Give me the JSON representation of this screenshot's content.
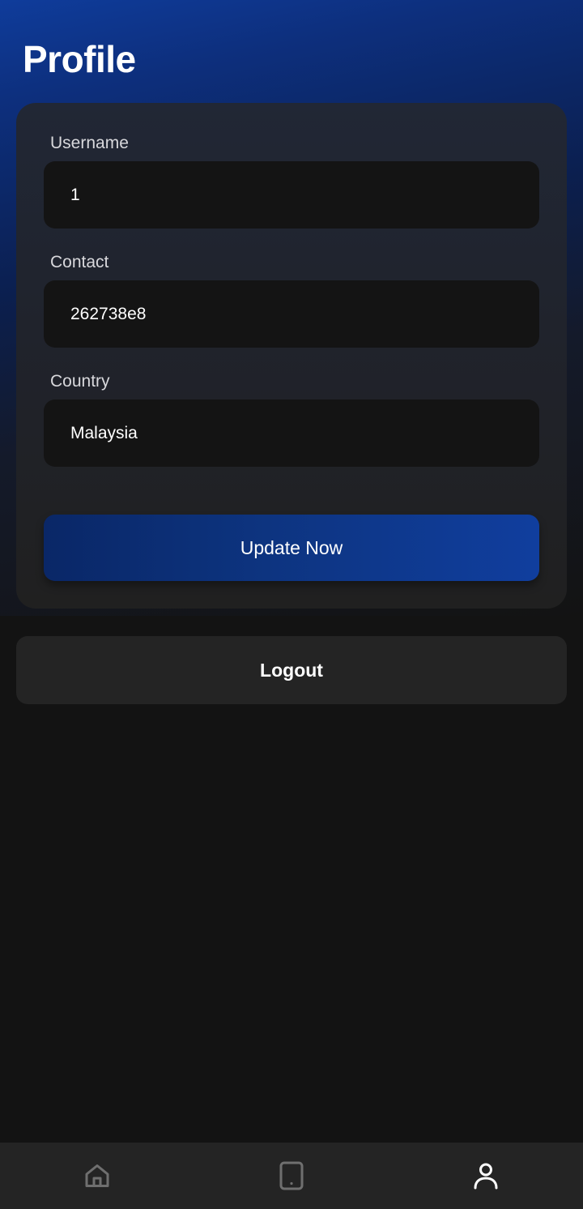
{
  "header": {
    "title": "Profile"
  },
  "form": {
    "username": {
      "label": "Username",
      "value": "1"
    },
    "contact": {
      "label": "Contact",
      "value": "262738e8"
    },
    "country": {
      "label": "Country",
      "value": "Malaysia"
    },
    "update_label": "Update Now"
  },
  "logout_label": "Logout",
  "bottom_nav": {
    "items": [
      {
        "icon": "home-icon",
        "active": false
      },
      {
        "icon": "tablet-icon",
        "active": false
      },
      {
        "icon": "person-icon",
        "active": true
      }
    ]
  },
  "colors": {
    "background": "#131313",
    "accent": "#0f3c9b",
    "card": "#202020",
    "input": "#141414",
    "nav_inactive": "#6f6f6f",
    "nav_active": "#ffffff"
  }
}
